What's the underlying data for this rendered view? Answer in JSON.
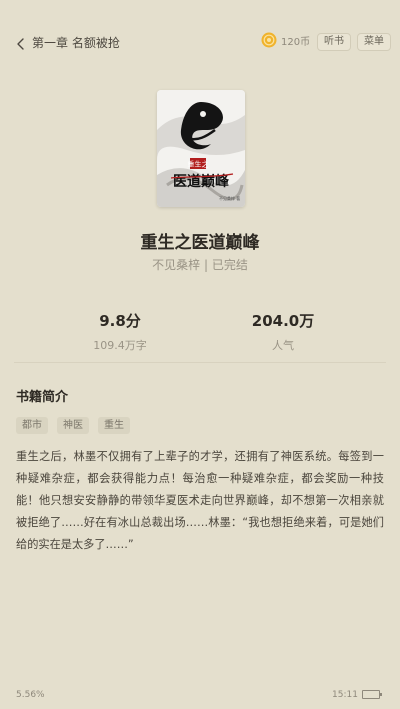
{
  "header": {
    "back_label": "第一章 名额被抢",
    "coins": "120币",
    "listen_label": "听书",
    "menu_label": "菜单"
  },
  "book": {
    "title": "重生之医道巅峰",
    "author": "不见桑梓",
    "separator": "|",
    "status": "已完结",
    "cover_lettering": "重生之医道巅峰"
  },
  "stats": {
    "score": "9.8分",
    "word_count": "109.4万字",
    "popularity": "204.0万",
    "popularity_label": "人气"
  },
  "intro": {
    "section_title": "书籍简介",
    "tags": [
      "都市",
      "神医",
      "重生"
    ],
    "description": "重生之后，林墨不仅拥有了上辈子的才学，还拥有了神医系统。每签到一种疑难杂症，都会获得能力点！每治愈一种疑难杂症，都会奖励一种技能！他只想安安静静的带领华夏医术走向世界巅峰，却不想第一次相亲就被拒绝了……好在有冰山总裁出场……林墨：“我也想拒绝来着，可是她们给的实在是太多了……”"
  },
  "footer": {
    "progress": "5.56%",
    "time": "15:11"
  },
  "colors": {
    "background": "#e4dfcd",
    "coin": "#f0b32c"
  },
  "icons": [
    "chevron-left-icon",
    "coin-icon",
    "battery-icon"
  ]
}
